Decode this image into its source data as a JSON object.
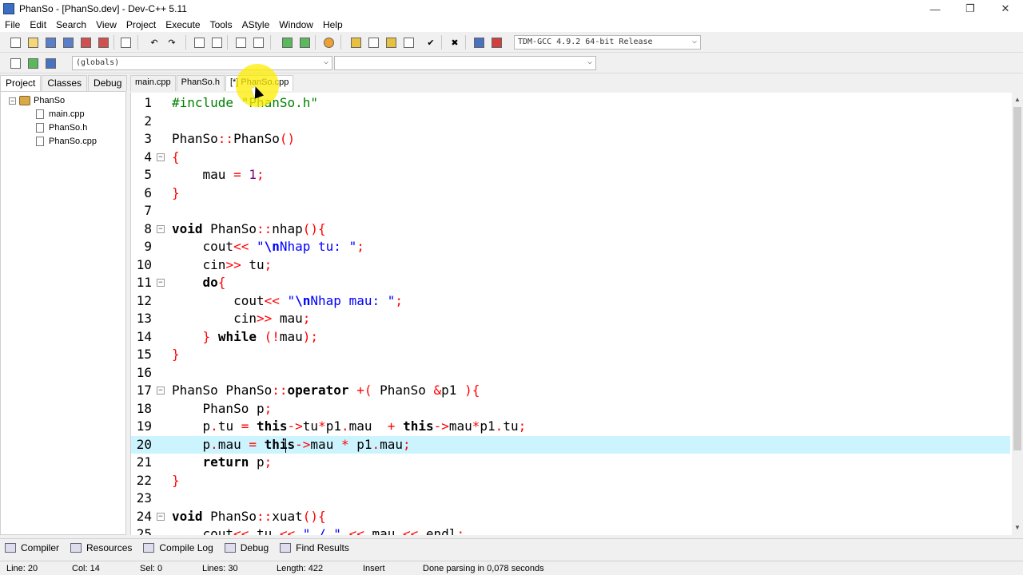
{
  "window": {
    "title": "PhanSo - [PhanSo.dev] - Dev-C++ 5.11",
    "controls": [
      "—",
      "❐",
      "✕"
    ]
  },
  "menu": [
    "File",
    "Edit",
    "Search",
    "View",
    "Project",
    "Execute",
    "Tools",
    "AStyle",
    "Window",
    "Help"
  ],
  "toolbar": {
    "compiler_select": "TDM-GCC 4.9.2 64-bit Release",
    "scope_select": "(globals)",
    "member_select": ""
  },
  "left_panel": {
    "tabs": [
      "Project",
      "Classes",
      "Debug"
    ],
    "active_tab": "Project",
    "project_name": "PhanSo",
    "files": [
      "main.cpp",
      "PhanSo.h",
      "PhanSo.cpp"
    ]
  },
  "editor_tabs": [
    "main.cpp",
    "PhanSo.h",
    "[*] PhanSo.cpp"
  ],
  "editor": {
    "lines": [
      {
        "n": "1",
        "fold": "",
        "html": "<span class=\"pp\">#include \"PhanSo.h\"</span>"
      },
      {
        "n": "2",
        "fold": "",
        "html": ""
      },
      {
        "n": "3",
        "fold": "",
        "html": "PhanSo<span class=\"sym\">::</span>PhanSo<span class=\"sym\">()</span>"
      },
      {
        "n": "4",
        "fold": "⊟",
        "html": "<span class=\"sym\">{</span>"
      },
      {
        "n": "5",
        "fold": "",
        "html": "    mau <span class=\"sym\">=</span> <span class=\"num\">1</span><span class=\"sym\">;</span>"
      },
      {
        "n": "6",
        "fold": "",
        "html": "<span class=\"sym\">}</span>"
      },
      {
        "n": "7",
        "fold": "",
        "html": ""
      },
      {
        "n": "8",
        "fold": "⊟",
        "html": "<span class=\"kw\">void</span> PhanSo<span class=\"sym\">::</span>nhap<span class=\"sym\">(){</span>"
      },
      {
        "n": "9",
        "fold": "",
        "html": "    cout<span class=\"sym\">&lt;&lt;</span> <span class=\"str\">\"<b>\\n</b>Nhap tu: \"</span><span class=\"sym\">;</span>"
      },
      {
        "n": "10",
        "fold": "",
        "html": "    cin<span class=\"sym\">&gt;&gt;</span> tu<span class=\"sym\">;</span>"
      },
      {
        "n": "11",
        "fold": "⊟",
        "html": "    <span class=\"kw\">do</span><span class=\"sym\">{</span>"
      },
      {
        "n": "12",
        "fold": "",
        "html": "        cout<span class=\"sym\">&lt;&lt;</span> <span class=\"str\">\"<b>\\n</b>Nhap mau: \"</span><span class=\"sym\">;</span>"
      },
      {
        "n": "13",
        "fold": "",
        "html": "        cin<span class=\"sym\">&gt;&gt;</span> mau<span class=\"sym\">;</span>"
      },
      {
        "n": "14",
        "fold": "",
        "html": "    <span class=\"sym\">}</span> <span class=\"kw\">while</span> <span class=\"sym\">(!</span>mau<span class=\"sym\">);</span>"
      },
      {
        "n": "15",
        "fold": "",
        "html": "<span class=\"sym\">}</span>"
      },
      {
        "n": "16",
        "fold": "",
        "html": ""
      },
      {
        "n": "17",
        "fold": "⊟",
        "html": "PhanSo PhanSo<span class=\"sym\">::</span><span class=\"kw\">operator</span> <span class=\"sym\">+(</span> PhanSo <span class=\"sym\">&amp;</span>p1 <span class=\"sym\">){</span>"
      },
      {
        "n": "18",
        "fold": "",
        "html": "    PhanSo p<span class=\"sym\">;</span>"
      },
      {
        "n": "19",
        "fold": "",
        "html": "    p<span class=\"sym\">.</span>tu <span class=\"sym\">=</span> <span class=\"kw\">this</span><span class=\"sym\">-&gt;</span>tu<span class=\"sym\">*</span>p1<span class=\"sym\">.</span>mau  <span class=\"sym\">+</span> <span class=\"kw\">this</span><span class=\"sym\">-&gt;</span>mau<span class=\"sym\">*</span>p1<span class=\"sym\">.</span>tu<span class=\"sym\">;</span>"
      },
      {
        "n": "20",
        "fold": "",
        "html": "    p<span class=\"sym\">.</span>mau <span class=\"sym\">=</span> <span class=\"kw\">this</span><span class=\"sym\">-&gt;</span>mau <span class=\"sym\">*</span> p1<span class=\"sym\">.</span>mau<span class=\"sym\">;</span>",
        "current": true
      },
      {
        "n": "21",
        "fold": "",
        "html": "    <span class=\"kw\">return</span> p<span class=\"sym\">;</span>"
      },
      {
        "n": "22",
        "fold": "",
        "html": "<span class=\"sym\">}</span>"
      },
      {
        "n": "23",
        "fold": "",
        "html": ""
      },
      {
        "n": "24",
        "fold": "⊟",
        "html": "<span class=\"kw\">void</span> PhanSo<span class=\"sym\">::</span>xuat<span class=\"sym\">(){</span>"
      },
      {
        "n": "25",
        "fold": "",
        "html": "    cout<span class=\"sym\">&lt;&lt;</span> tu <span class=\"sym\">&lt;&lt;</span> <span class=\"str\">\" / \"</span> <span class=\"sym\">&lt;&lt;</span> mau <span class=\"sym\">&lt;&lt;</span> endl<span class=\"sym\">;</span>"
      }
    ]
  },
  "bottom_tabs": [
    "Compiler",
    "Resources",
    "Compile Log",
    "Debug",
    "Find Results"
  ],
  "status": {
    "line": "Line:   20",
    "col": "Col:   14",
    "sel": "Sel:   0",
    "lines": "Lines:   30",
    "length": "Length:   422",
    "mode": "Insert",
    "message": "Done parsing in 0,078 seconds"
  }
}
